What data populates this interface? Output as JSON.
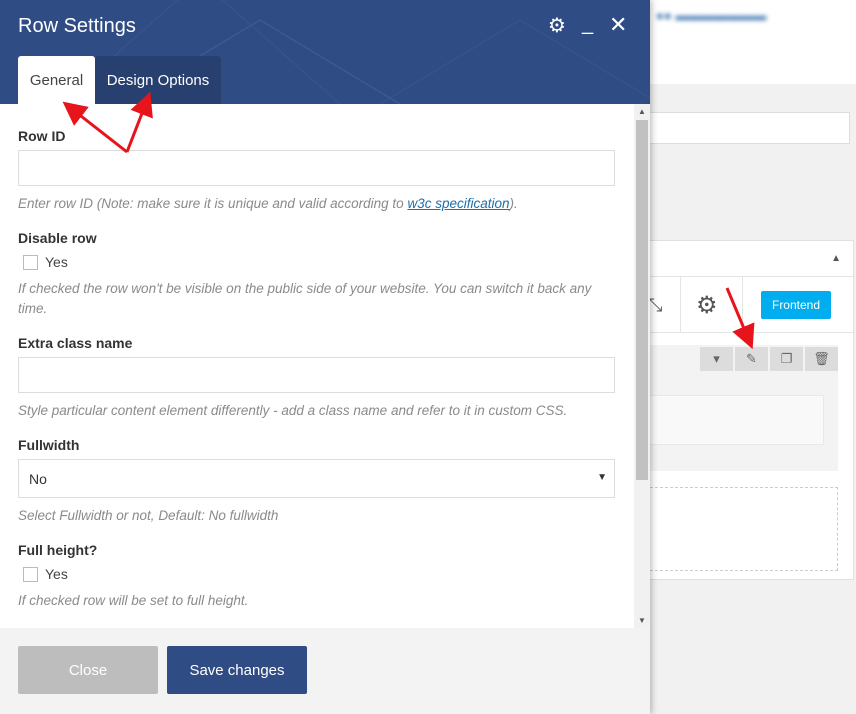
{
  "modal": {
    "title": "Row Settings",
    "icons": {
      "settings": "gear-icon",
      "minimize": "minimize-icon",
      "close": "close-icon"
    },
    "tabs": [
      {
        "label": "General",
        "active": true
      },
      {
        "label": "Design Options",
        "active": false
      }
    ],
    "fields": {
      "row_id": {
        "label": "Row ID",
        "value": "",
        "help_prefix": "Enter row ID (Note: make sure it is unique and valid according to ",
        "help_link": "w3c specification",
        "help_suffix": ")."
      },
      "disable_row": {
        "label": "Disable row",
        "checkbox_label": "Yes",
        "checked": false,
        "help": "If checked the row won't be visible on the public side of your website. You can switch it back any time."
      },
      "extra_class": {
        "label": "Extra class name",
        "value": "",
        "help": "Style particular content element differently - add a class name and refer to it in custom CSS."
      },
      "fullwidth": {
        "label": "Fullwidth",
        "selected": "No",
        "help": "Select Fullwidth or not, Default: No fullwidth"
      },
      "full_height": {
        "label": "Full height?",
        "checkbox_label": "Yes",
        "checked": false,
        "help": "If checked row will be set to full height."
      }
    },
    "footer": {
      "close_label": "Close",
      "save_label": "Save changes"
    }
  },
  "background": {
    "frontend_label": "Frontend"
  },
  "colors": {
    "header": "#2f4c84",
    "active_tab": "#ffffff",
    "inactive_tab": "#27406f",
    "save_button": "#2f4c84",
    "close_button": "#bdbdbd",
    "frontend_button": "#00aef0",
    "annotation_arrow": "#e8141b"
  }
}
